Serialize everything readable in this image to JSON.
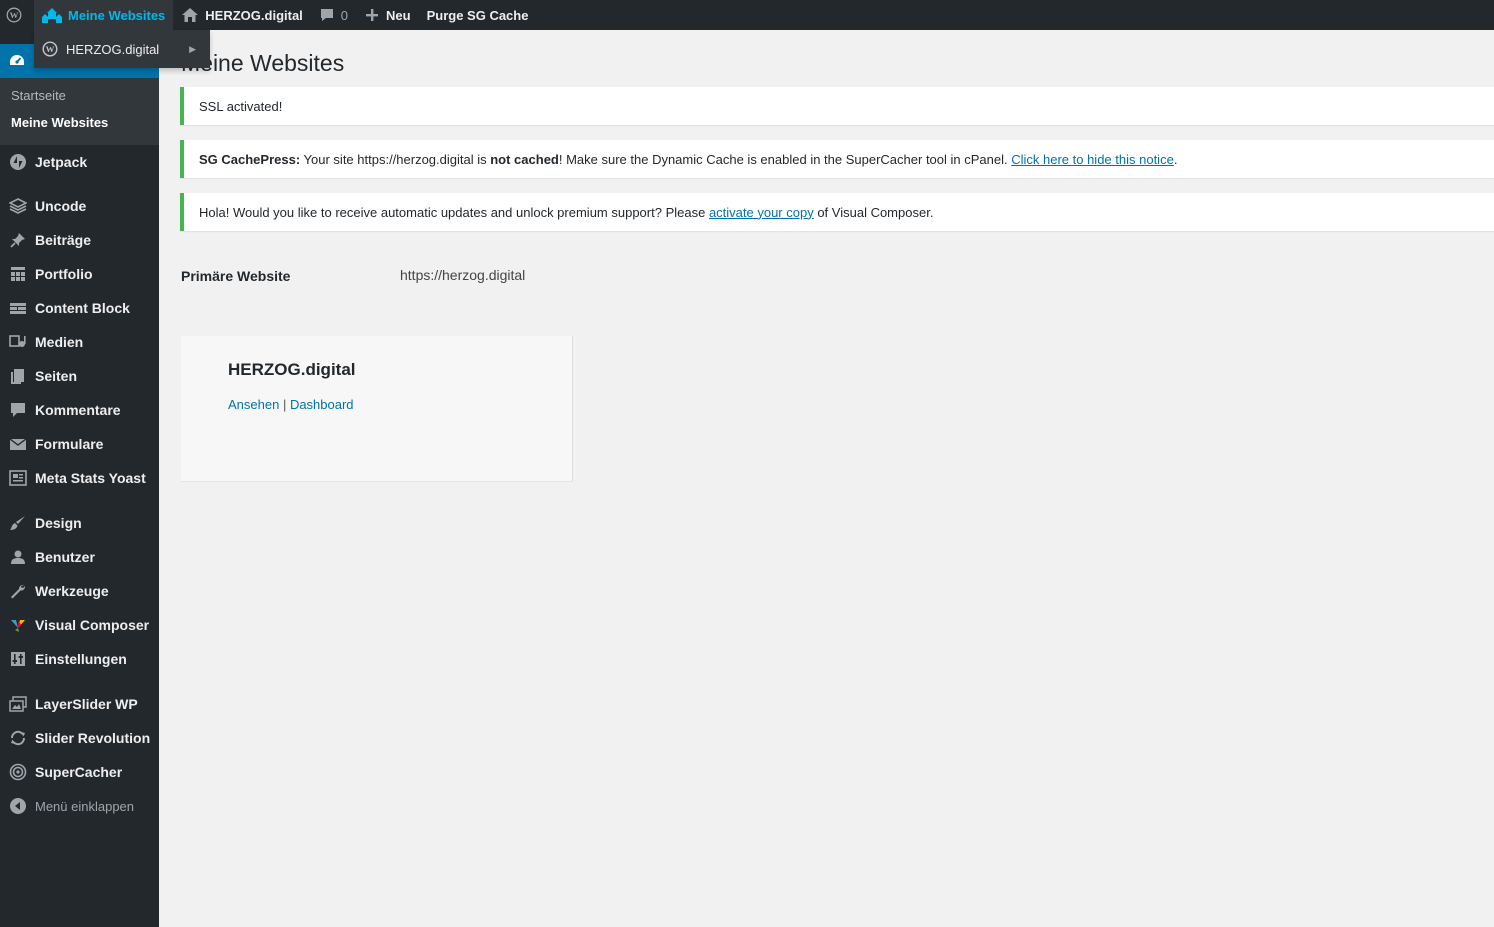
{
  "adminbar": {
    "my_sites": "Meine Websites",
    "site_name": "HERZOG.digital",
    "comments_count": "0",
    "new": "Neu",
    "purge": "Purge SG Cache"
  },
  "dropdown": {
    "site": "HERZOG.digital"
  },
  "sidebar": {
    "submenu": {
      "home": "Startseite",
      "my_sites": "Meine Websites"
    },
    "items": [
      {
        "label": "Jetpack",
        "icon": "jetpack-icon"
      },
      {
        "label": "Uncode",
        "icon": "layers-icon"
      },
      {
        "label": "Beiträge",
        "icon": "pin-icon"
      },
      {
        "label": "Portfolio",
        "icon": "portfolio-icon"
      },
      {
        "label": "Content Block",
        "icon": "content-block-icon"
      },
      {
        "label": "Medien",
        "icon": "media-icon"
      },
      {
        "label": "Seiten",
        "icon": "pages-icon"
      },
      {
        "label": "Kommentare",
        "icon": "comment-icon"
      },
      {
        "label": "Formulare",
        "icon": "mail-icon"
      },
      {
        "label": "Meta Stats Yoast",
        "icon": "stats-icon"
      },
      {
        "label": "Design",
        "icon": "brush-icon"
      },
      {
        "label": "Benutzer",
        "icon": "user-icon"
      },
      {
        "label": "Werkzeuge",
        "icon": "wrench-icon"
      },
      {
        "label": "Visual Composer",
        "icon": "visual-composer-icon"
      },
      {
        "label": "Einstellungen",
        "icon": "settings-icon"
      },
      {
        "label": "LayerSlider WP",
        "icon": "layerslider-icon"
      },
      {
        "label": "Slider Revolution",
        "icon": "refresh-icon"
      },
      {
        "label": "SuperCacher",
        "icon": "supercacher-icon"
      }
    ],
    "collapse": "Menü einklappen"
  },
  "main": {
    "title": "Meine Websites",
    "notices": {
      "ssl": "SSL activated!",
      "sg_bold": "SG CachePress:",
      "sg_text1": " Your site https://herzog.digital is ",
      "sg_notcached": "not cached",
      "sg_text2": "! Make sure the Dynamic Cache is enabled in the SuperCacher tool in cPanel. ",
      "sg_link": "Click here to hide this notice",
      "sg_end": ".",
      "vc_text1": "Hola! Would you like to receive automatic updates and unlock premium support? Please ",
      "vc_link": "activate your copy",
      "vc_text2": " of Visual Composer."
    },
    "primary_label": "Primäre Website",
    "primary_value": "https://herzog.digital",
    "site_card": {
      "name": "HERZOG.digital",
      "view": "Ansehen",
      "sep": " | ",
      "dashboard": "Dashboard"
    }
  },
  "colors": {
    "adminbar_bg": "#23282d",
    "accent": "#0073aa",
    "link_active": "#00b9eb",
    "notice_success": "#46b450"
  }
}
